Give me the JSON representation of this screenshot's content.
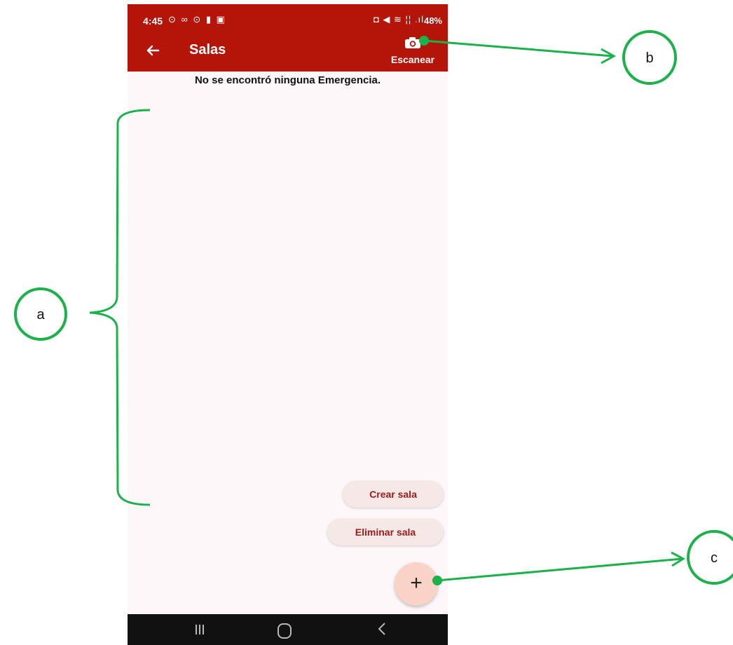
{
  "status_bar": {
    "time": "4:45",
    "left_icons": "⊙ ∞ ⊙ ▮ ▣",
    "right_icons": "◘ ◀ ≋ ¦¦ .ıl",
    "battery": "48%"
  },
  "app_bar": {
    "title": "Salas",
    "scan_label": "Escanear",
    "icons": {
      "back": "arrow-left-icon",
      "scan": "camera-icon"
    }
  },
  "content": {
    "empty_message": "No se encontró ninguna Emergencia."
  },
  "actions": {
    "create_room": "Crear sala",
    "delete_room": "Eliminar sala",
    "fab_symbol": "+"
  },
  "nav_bar": {
    "icons": [
      "recent-apps-icon",
      "home-icon",
      "back-icon"
    ]
  },
  "annotations": {
    "a": "a",
    "b": "b",
    "c": "c"
  },
  "colors": {
    "app_bar": "#b51409",
    "annotation": "#1db14b",
    "background": "#fdf7f9",
    "accent_text": "#a11b1b",
    "fab": "#f8d3c6"
  }
}
